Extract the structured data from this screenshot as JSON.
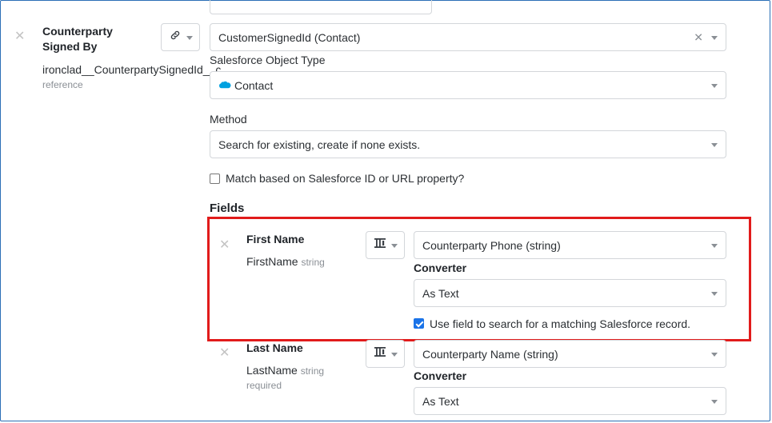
{
  "counterparty": {
    "title": "Counterparty Signed By",
    "api_name": "ironclad__CounterpartySignedId__c",
    "type": "reference",
    "source_value": "CustomerSignedId (Contact)"
  },
  "object_type": {
    "label": "Salesforce Object Type",
    "value": "Contact"
  },
  "method": {
    "label": "Method",
    "value": "Search for existing, create if none exists."
  },
  "match_checkbox": {
    "label": "Match based on Salesforce ID or URL property?",
    "checked": false
  },
  "fields_heading": "Fields",
  "fields": [
    {
      "title": "First Name",
      "api_name": "FirstName",
      "type": "string",
      "required": "",
      "source_value": "Counterparty Phone (string)",
      "converter_label": "Converter",
      "converter_value": "As Text",
      "search_label": "Use field to search for a matching Salesforce record.",
      "search_checked": true
    },
    {
      "title": "Last Name",
      "api_name": "LastName",
      "type": "string",
      "required": "required",
      "source_value": "Counterparty Name (string)",
      "converter_label": "Converter",
      "converter_value": "As Text"
    }
  ],
  "colors": {
    "highlight": "#e11b1b",
    "frame": "#2b6fb6",
    "salesforce_blue": "#00a1e0",
    "checkbox_blue": "#1a73e8"
  },
  "icons": {
    "remove": "close-icon",
    "link": "link-icon",
    "mapping": "field-mapping-icon",
    "salesforce": "salesforce-cloud-icon",
    "dropdown": "chevron-down-icon"
  }
}
